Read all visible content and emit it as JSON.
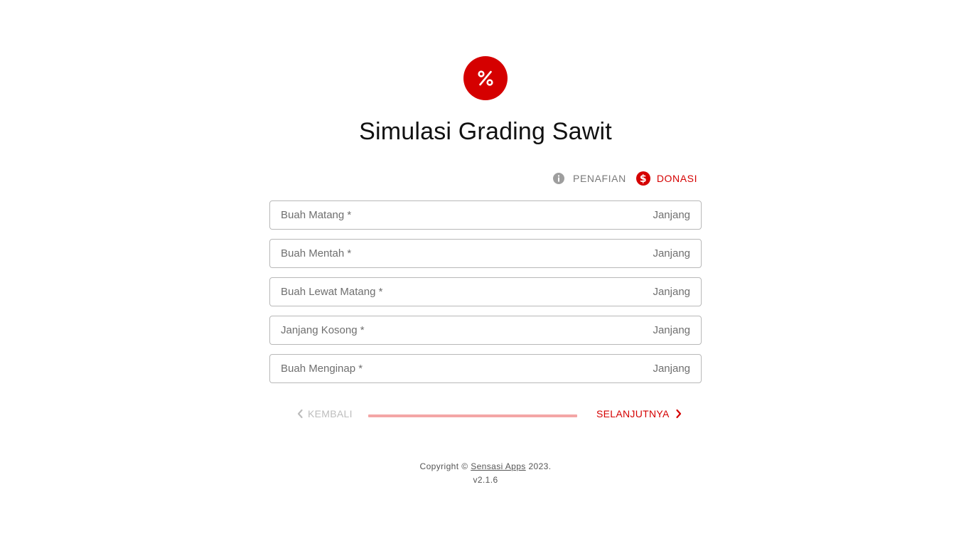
{
  "app": {
    "title": "Simulasi Grading Sawit",
    "brand_color": "#d50000"
  },
  "logo": {
    "icon": "percent-icon"
  },
  "links": {
    "disclaimer_label": "PENAFIAN",
    "disclaimer_icon": "info-icon",
    "donate_label": "DONASI",
    "donate_icon": "dollar-circle-icon"
  },
  "form": {
    "fields": [
      {
        "label": "Buah Matang *",
        "unit": "Janjang",
        "value": ""
      },
      {
        "label": "Buah Mentah *",
        "unit": "Janjang",
        "value": ""
      },
      {
        "label": "Buah Lewat Matang *",
        "unit": "Janjang",
        "value": ""
      },
      {
        "label": "Janjang Kosong *",
        "unit": "Janjang",
        "value": ""
      },
      {
        "label": "Buah Menginap *",
        "unit": "Janjang",
        "value": ""
      }
    ]
  },
  "stepper": {
    "back_label": "KEMBALI",
    "next_label": "SELANJUTNYA",
    "back_icon": "chevron-left-icon",
    "next_icon": "chevron-right-icon",
    "progress": 0
  },
  "footer": {
    "copyright_prefix": "Copyright ©",
    "company": "Sensasi Apps",
    "year_suffix": "2023.",
    "version": "v2.1.6"
  }
}
